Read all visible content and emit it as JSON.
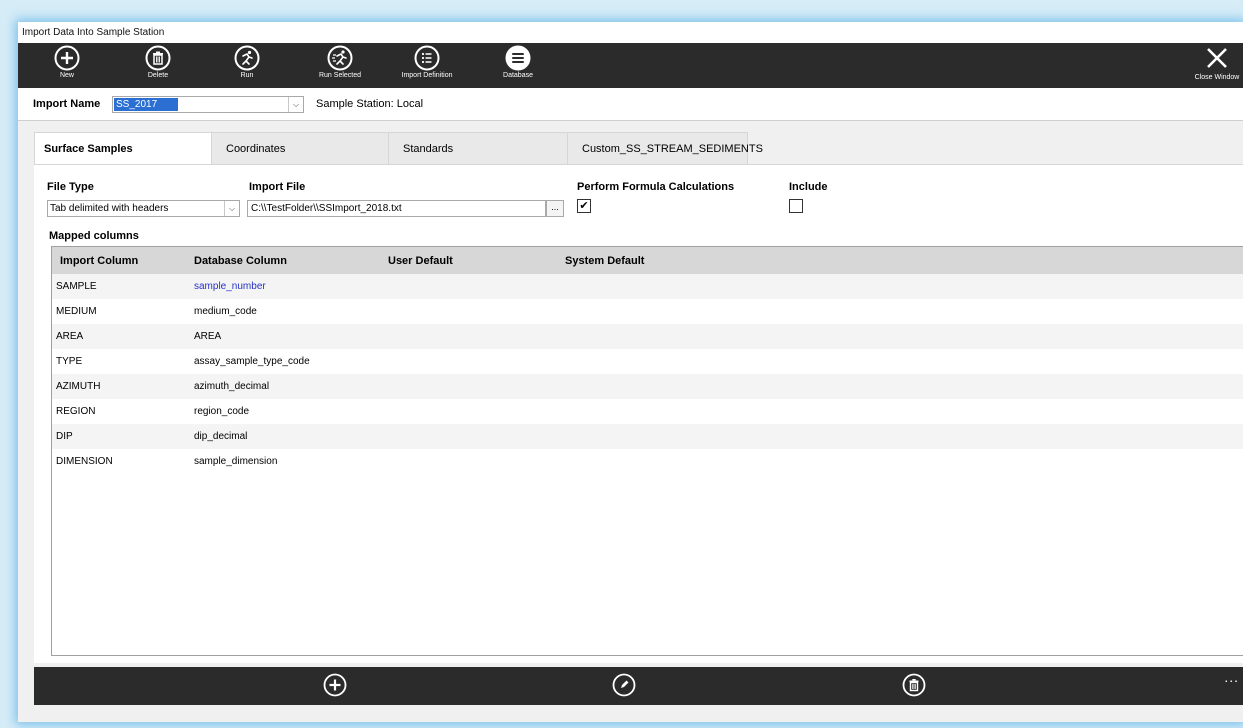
{
  "window": {
    "title": "Import Data Into Sample Station"
  },
  "toolbar": {
    "buttons": [
      {
        "label": "New",
        "icon": "plus-circle-icon"
      },
      {
        "label": "Delete",
        "icon": "trash-circle-icon"
      },
      {
        "label": "Run",
        "icon": "runner-circle-icon"
      },
      {
        "label": "Run Selected",
        "icon": "runner-selected-circle-icon"
      },
      {
        "label": "Import Definition",
        "icon": "list-circle-icon"
      },
      {
        "label": "Database",
        "icon": "database-circle-icon"
      }
    ],
    "close_label": "Close Window"
  },
  "import_bar": {
    "label": "Import Name",
    "value": "SS_2017",
    "station": "Sample Station: Local"
  },
  "tabs": [
    {
      "label": "Surface Samples",
      "active": true
    },
    {
      "label": "Coordinates",
      "active": false
    },
    {
      "label": "Standards",
      "active": false
    },
    {
      "label": "Custom_SS_STREAM_SEDIMENTS",
      "active": false
    }
  ],
  "form": {
    "file_type_label": "File Type",
    "file_type_value": "Tab delimited with headers",
    "import_file_label": "Import File",
    "import_file_value": "C:\\\\TestFolder\\\\SSImport_2018.txt",
    "browse_label": "...",
    "formula_label": "Perform Formula Calculations",
    "formula_checked": true,
    "include_label": "Include",
    "include_checked": false,
    "mapped_label": "Mapped columns"
  },
  "grid": {
    "headers": [
      "Import Column",
      "Database Column",
      "User Default",
      "System Default"
    ],
    "rows": [
      {
        "import": "SAMPLE",
        "db": "sample_number"
      },
      {
        "import": "MEDIUM",
        "db": "medium_code"
      },
      {
        "import": "AREA",
        "db": "AREA"
      },
      {
        "import": "TYPE",
        "db": "assay_sample_type_code"
      },
      {
        "import": "AZIMUTH",
        "db": "azimuth_decimal"
      },
      {
        "import": "REGION",
        "db": "region_code"
      },
      {
        "import": "DIP",
        "db": "dip_decimal"
      },
      {
        "import": "DIMENSION",
        "db": "sample_dimension"
      }
    ]
  },
  "bottombar": {
    "more_label": "..."
  },
  "colors": {
    "toolbar_bg": "#2b2b2b",
    "link": "#2632c8",
    "selection": "#2a6fd1"
  }
}
